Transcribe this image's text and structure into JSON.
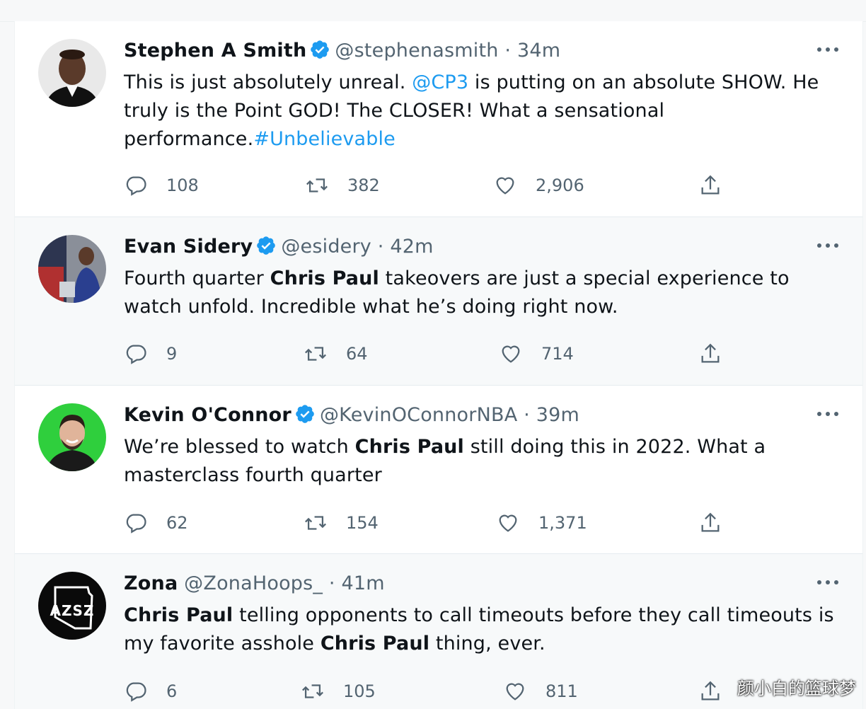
{
  "tweets": [
    {
      "name": "Stephen A Smith",
      "verified": true,
      "handle": "@stephenasmith",
      "sep": "·",
      "time": "34m",
      "text": [
        {
          "t": "This is just absolutely unreal. "
        },
        {
          "t": "@CP3",
          "style": "link"
        },
        {
          "t": "  is putting on an absolute SHOW. He truly is the Point GOD! The CLOSER! What a sensational performance."
        },
        {
          "t": "#Unbelievable",
          "style": "link"
        }
      ],
      "replies": "108",
      "retweets": "382",
      "likes": "2,906"
    },
    {
      "name": "Evan Sidery",
      "verified": true,
      "handle": "@esidery",
      "sep": "·",
      "time": "42m",
      "text": [
        {
          "t": "Fourth quarter "
        },
        {
          "t": "Chris Paul",
          "style": "bold"
        },
        {
          "t": " takeovers are just a special experience to watch unfold. Incredible what he’s doing right now."
        }
      ],
      "replies": "9",
      "retweets": "64",
      "likes": "714"
    },
    {
      "name": "Kevin O'Connor",
      "verified": true,
      "handle": "@KevinOConnorNBA",
      "sep": "·",
      "time": "39m",
      "text": [
        {
          "t": "We’re blessed to watch "
        },
        {
          "t": "Chris Paul",
          "style": "bold"
        },
        {
          "t": " still doing this in 2022. What a masterclass fourth quarter"
        }
      ],
      "replies": "62",
      "retweets": "154",
      "likes": "1,371"
    },
    {
      "name": "Zona",
      "verified": false,
      "handle": "@ZonaHoops_",
      "sep": "·",
      "time": "41m",
      "text": [
        {
          "t": "Chris Paul",
          "style": "bold"
        },
        {
          "t": " telling opponents to call timeouts before they call timeouts is my favorite asshole "
        },
        {
          "t": "Chris Paul",
          "style": "bold"
        },
        {
          "t": " thing, ever."
        }
      ],
      "replies": "6",
      "retweets": "105",
      "likes": "811"
    }
  ],
  "avatar_logo_text": "AZSZ",
  "watermark": "颜小白的篮球梦",
  "colors": {
    "link": "#1d9bf0",
    "verified": "#1d9bf0",
    "secondary": "#536471",
    "shaded_bg": "#f7f9fa"
  },
  "icons": {
    "reply": "speech-bubble-icon",
    "retweet": "retweet-arrows-icon",
    "like": "heart-icon",
    "share": "share-upload-icon",
    "more": "more-dots-icon",
    "verified": "verified-badge-icon"
  }
}
